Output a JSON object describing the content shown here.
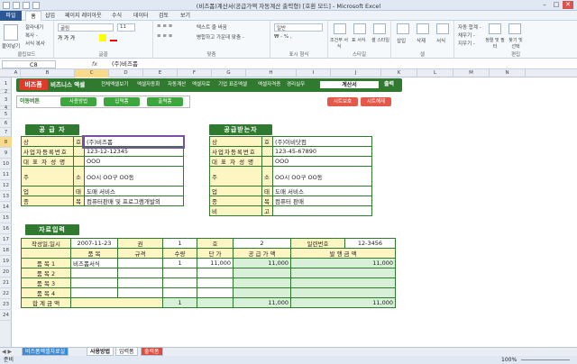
{
  "window": {
    "title": "(비즈폼)계산서(공급가액 자동계산 출력형) [호환 모드] - Microsoft Excel"
  },
  "menu": {
    "file": "파일",
    "tabs": [
      "홈",
      "삽입",
      "페이지 레이아웃",
      "수식",
      "데이터",
      "검토",
      "보기"
    ]
  },
  "ribbon": {
    "clipboard": {
      "label": "클립보드",
      "paste": "붙여넣기",
      "cut": "잘라내기",
      "copy": "복사 -",
      "format": "서식 복사"
    },
    "font": {
      "label": "글꼴",
      "name": "굴림",
      "size": "11"
    },
    "align": {
      "label": "맞춤",
      "wrap": "텍스트 줄 바꿈",
      "merge": "병합하고 가운데 맞춤 -"
    },
    "number": {
      "label": "표시 형식",
      "format": "일반"
    },
    "styles": {
      "label": "스타일",
      "cond": "조건부 서식",
      "table": "표 서식",
      "cell": "셀 스타일"
    },
    "cells": {
      "label": "셀",
      "insert": "삽입",
      "delete": "삭제",
      "format": "서식"
    },
    "edit": {
      "label": "편집",
      "autosum": "자동 합계 -",
      "fill": "채우기 -",
      "clear": "지우기 -",
      "sort": "정렬 및 필터",
      "find": "찾기 및 선택"
    }
  },
  "formula_bar": {
    "cell": "C8",
    "fx": "fx",
    "content": "(주)비즈폼"
  },
  "columns": [
    "A",
    "B",
    "C",
    "D",
    "E",
    "F",
    "G",
    "H",
    "I",
    "J",
    "K",
    "L",
    "M",
    "N"
  ],
  "rows": [
    "1",
    "2",
    "3",
    "4",
    "5",
    "6",
    "7",
    "8",
    "9",
    "10",
    "11",
    "12",
    "13",
    "14",
    "15",
    "16",
    "17",
    "18",
    "19",
    "20",
    "21",
    "22",
    "23",
    "24"
  ],
  "nav": {
    "logo": "비즈폼",
    "logo2": "비즈니스 엑셀",
    "items": [
      "전체엑셀보기",
      "엑셀자동화",
      "자동계산",
      "엑셀자료",
      "기업 표준엑셀",
      "엑셀자격증",
      "경리실무"
    ],
    "calc_label": "계산서",
    "print": "출력"
  },
  "move": {
    "label": "이동버튼",
    "buttons": [
      "사용방법",
      "입력폼",
      "출력폼"
    ],
    "red_buttons": [
      "시트보호",
      "시트해제"
    ]
  },
  "supplier": {
    "header": "공 급 자",
    "rows": [
      {
        "label": "상",
        "sub": "호",
        "value": "(주)비즈폼"
      },
      {
        "label": "사업자등록번호",
        "sub": "",
        "value": "123-12-12345"
      },
      {
        "label": "대 표 자 성 명",
        "sub": "",
        "value": "OOO"
      },
      {
        "label": "주",
        "sub": "소",
        "value": "OO시 OO구 OO동"
      },
      {
        "label": "업",
        "sub": "태",
        "value": "도매 서비스"
      },
      {
        "label": "종",
        "sub": "목",
        "value": "컴퓨터판매 및 프로그램개발외"
      }
    ]
  },
  "receiver": {
    "header": "공급받는자",
    "rows": [
      {
        "label": "상",
        "sub": "호",
        "value": "(주)이비닷컴"
      },
      {
        "label": "사업자등록번호",
        "sub": "",
        "value": "123-45-67890"
      },
      {
        "label": "대 표 자 성 명",
        "sub": "",
        "value": "OOO"
      },
      {
        "label": "주",
        "sub": "소",
        "value": "OO시 OO구 OO동"
      },
      {
        "label": "업",
        "sub": "태",
        "value": "도매 서비스"
      },
      {
        "label": "종",
        "sub": "목",
        "value": "컴퓨터 판매"
      },
      {
        "label": "비",
        "sub": "고",
        "value": ""
      }
    ]
  },
  "data_entry": {
    "header": "자료입력",
    "row17": {
      "date_label": "작성일,일시",
      "date": "2007-11-23",
      "vol_label": "권",
      "vol": "1",
      "no_label": "호",
      "no": "2",
      "serial_label": "일련번호",
      "serial": "12-3456"
    },
    "headers": [
      "품  목",
      "규격",
      "수량",
      "단  가",
      "공 급 가 액",
      "발 행 금 액"
    ],
    "items": [
      {
        "label": "품  목  1",
        "name": "비즈폼서식",
        "spec": "",
        "qty": "1",
        "price": "11,000",
        "supply": "11,000",
        "issue": "11,000"
      },
      {
        "label": "품  목  2",
        "name": "",
        "spec": "",
        "qty": "",
        "price": "",
        "supply": "",
        "issue": ""
      },
      {
        "label": "품  목  3",
        "name": "",
        "spec": "",
        "qty": "",
        "price": "",
        "supply": "",
        "issue": ""
      },
      {
        "label": "품  목  4",
        "name": "",
        "spec": "",
        "qty": "",
        "price": "",
        "supply": "",
        "issue": ""
      }
    ],
    "total": {
      "label": "합 계 금 액",
      "qty": "1",
      "supply": "11,000",
      "issue": "11,000"
    }
  },
  "sheet_tabs": [
    "비즈폼엑셀자료실",
    "사용방법",
    "입력폼",
    "출력폼"
  ],
  "status": {
    "ready": "준비",
    "zoom": "100%"
  }
}
